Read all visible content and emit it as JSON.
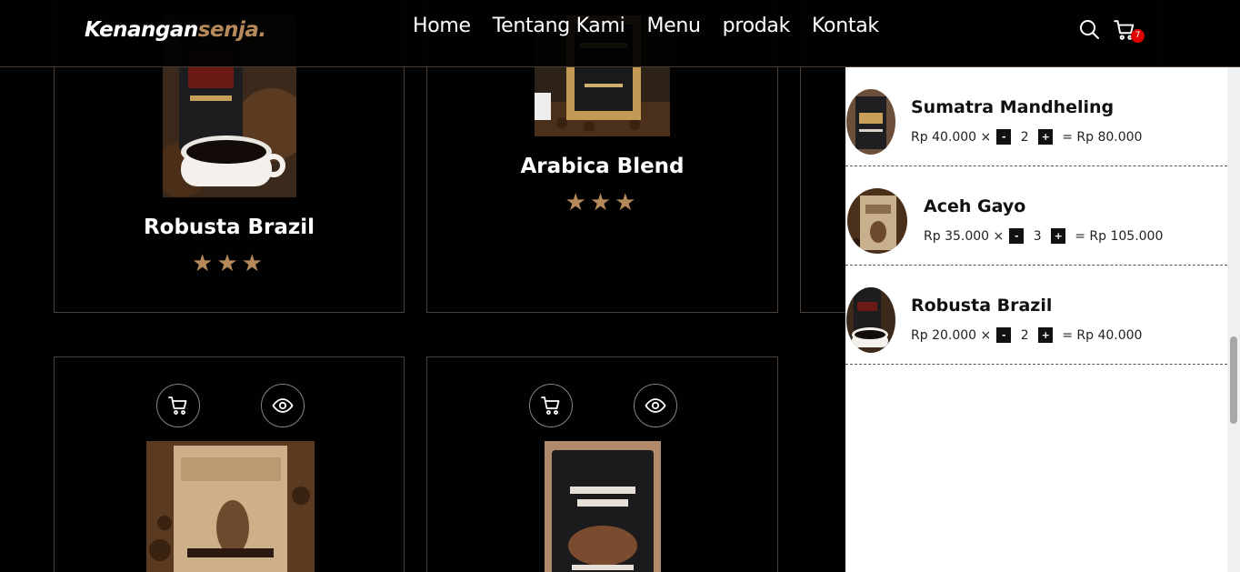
{
  "brand": {
    "name_main": "Kenangan",
    "name_accent": "senja."
  },
  "nav": {
    "links": [
      {
        "label": "Home"
      },
      {
        "label": "Tentang Kami"
      },
      {
        "label": "Menu"
      },
      {
        "label": "prodak"
      },
      {
        "label": "Kontak"
      }
    ],
    "cart_count": "7"
  },
  "products": [
    {
      "name": "Robusta Brazil",
      "rating": 3
    },
    {
      "name": "Arabica Blend",
      "rating": 3
    }
  ],
  "cart": {
    "items": [
      {
        "name": "Sumatra Mandheling",
        "price": "Rp 40.000 ×",
        "minus": "-",
        "qty": "2",
        "plus": "+",
        "total": "= Rp 80.000"
      },
      {
        "name": "Aceh Gayo",
        "price": "Rp 35.000 ×",
        "minus": "-",
        "qty": "3",
        "plus": "+",
        "total": "= Rp 105.000"
      },
      {
        "name": "Robusta Brazil",
        "price": "Rp 20.000 ×",
        "minus": "-",
        "qty": "2",
        "plus": "+",
        "total": "= Rp 40.000"
      }
    ]
  },
  "colors": {
    "accent": "#b6895b",
    "badge": "#e00000",
    "background": "#010101"
  },
  "icons": {
    "search": "search-icon",
    "cart": "cart-icon",
    "view": "eye-icon",
    "rating": "star-icon"
  }
}
